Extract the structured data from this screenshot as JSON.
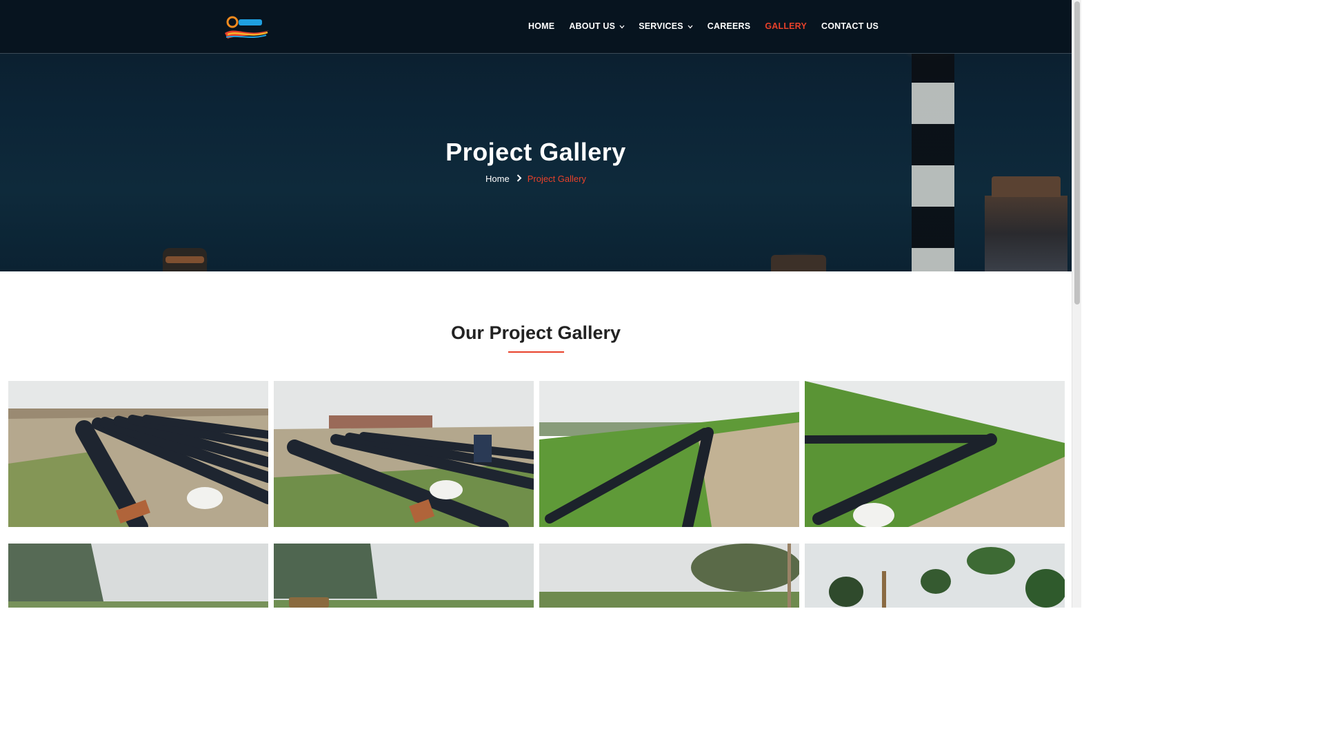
{
  "brand": {
    "accent": "#e8412a",
    "nav_bg": "#07141f"
  },
  "nav": {
    "logo_icon": "company-logo",
    "items": [
      {
        "label": "HOME",
        "dropdown": false,
        "active": false
      },
      {
        "label": "ABOUT US",
        "dropdown": true,
        "active": false
      },
      {
        "label": "SERVICES",
        "dropdown": true,
        "active": false
      },
      {
        "label": "CAREERS",
        "dropdown": false,
        "active": false
      },
      {
        "label": "GALLERY",
        "dropdown": false,
        "active": true
      },
      {
        "label": "CONTACT US",
        "dropdown": false,
        "active": false
      }
    ]
  },
  "hero": {
    "title": "Project Gallery",
    "breadcrumb": {
      "home": "Home",
      "separator_icon": "chevron-right-icon",
      "current": "Project Gallery"
    }
  },
  "section": {
    "title": "Our Project Gallery"
  },
  "gallery": {
    "row1": [
      "pipes-stacked-field",
      "worker-at-pipes",
      "pipeline-green-field",
      "pipeline-on-embankment"
    ],
    "row2": [
      "misty-field",
      "tractor-field",
      "village-trees-field",
      "palm-trees-site"
    ]
  }
}
